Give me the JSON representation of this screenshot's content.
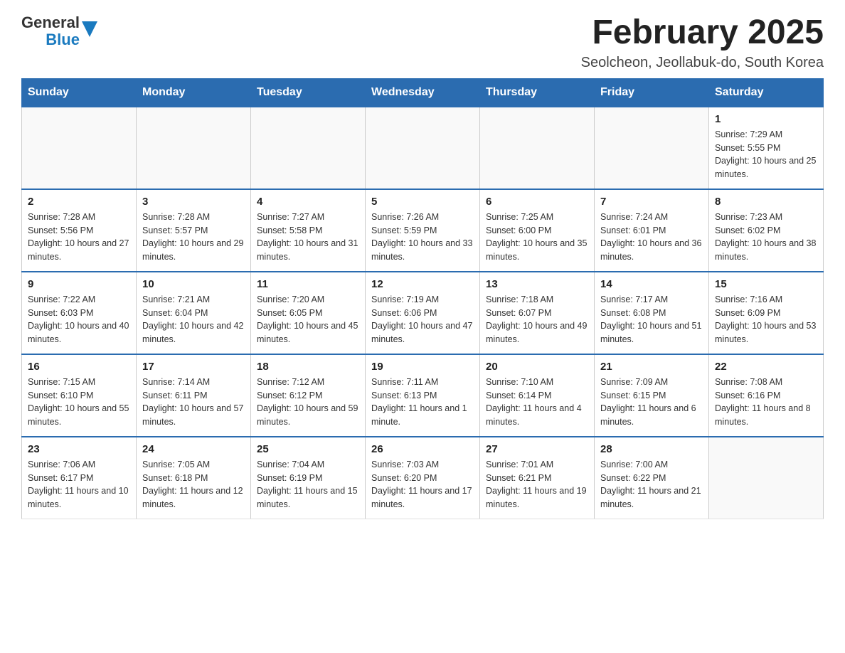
{
  "header": {
    "logo_general": "General",
    "logo_blue": "Blue",
    "month_title": "February 2025",
    "location": "Seolcheon, Jeollabuk-do, South Korea"
  },
  "days_of_week": [
    "Sunday",
    "Monday",
    "Tuesday",
    "Wednesday",
    "Thursday",
    "Friday",
    "Saturday"
  ],
  "weeks": [
    {
      "days": [
        {
          "number": "",
          "info": ""
        },
        {
          "number": "",
          "info": ""
        },
        {
          "number": "",
          "info": ""
        },
        {
          "number": "",
          "info": ""
        },
        {
          "number": "",
          "info": ""
        },
        {
          "number": "",
          "info": ""
        },
        {
          "number": "1",
          "info": "Sunrise: 7:29 AM\nSunset: 5:55 PM\nDaylight: 10 hours and 25 minutes."
        }
      ]
    },
    {
      "days": [
        {
          "number": "2",
          "info": "Sunrise: 7:28 AM\nSunset: 5:56 PM\nDaylight: 10 hours and 27 minutes."
        },
        {
          "number": "3",
          "info": "Sunrise: 7:28 AM\nSunset: 5:57 PM\nDaylight: 10 hours and 29 minutes."
        },
        {
          "number": "4",
          "info": "Sunrise: 7:27 AM\nSunset: 5:58 PM\nDaylight: 10 hours and 31 minutes."
        },
        {
          "number": "5",
          "info": "Sunrise: 7:26 AM\nSunset: 5:59 PM\nDaylight: 10 hours and 33 minutes."
        },
        {
          "number": "6",
          "info": "Sunrise: 7:25 AM\nSunset: 6:00 PM\nDaylight: 10 hours and 35 minutes."
        },
        {
          "number": "7",
          "info": "Sunrise: 7:24 AM\nSunset: 6:01 PM\nDaylight: 10 hours and 36 minutes."
        },
        {
          "number": "8",
          "info": "Sunrise: 7:23 AM\nSunset: 6:02 PM\nDaylight: 10 hours and 38 minutes."
        }
      ]
    },
    {
      "days": [
        {
          "number": "9",
          "info": "Sunrise: 7:22 AM\nSunset: 6:03 PM\nDaylight: 10 hours and 40 minutes."
        },
        {
          "number": "10",
          "info": "Sunrise: 7:21 AM\nSunset: 6:04 PM\nDaylight: 10 hours and 42 minutes."
        },
        {
          "number": "11",
          "info": "Sunrise: 7:20 AM\nSunset: 6:05 PM\nDaylight: 10 hours and 45 minutes."
        },
        {
          "number": "12",
          "info": "Sunrise: 7:19 AM\nSunset: 6:06 PM\nDaylight: 10 hours and 47 minutes."
        },
        {
          "number": "13",
          "info": "Sunrise: 7:18 AM\nSunset: 6:07 PM\nDaylight: 10 hours and 49 minutes."
        },
        {
          "number": "14",
          "info": "Sunrise: 7:17 AM\nSunset: 6:08 PM\nDaylight: 10 hours and 51 minutes."
        },
        {
          "number": "15",
          "info": "Sunrise: 7:16 AM\nSunset: 6:09 PM\nDaylight: 10 hours and 53 minutes."
        }
      ]
    },
    {
      "days": [
        {
          "number": "16",
          "info": "Sunrise: 7:15 AM\nSunset: 6:10 PM\nDaylight: 10 hours and 55 minutes."
        },
        {
          "number": "17",
          "info": "Sunrise: 7:14 AM\nSunset: 6:11 PM\nDaylight: 10 hours and 57 minutes."
        },
        {
          "number": "18",
          "info": "Sunrise: 7:12 AM\nSunset: 6:12 PM\nDaylight: 10 hours and 59 minutes."
        },
        {
          "number": "19",
          "info": "Sunrise: 7:11 AM\nSunset: 6:13 PM\nDaylight: 11 hours and 1 minute."
        },
        {
          "number": "20",
          "info": "Sunrise: 7:10 AM\nSunset: 6:14 PM\nDaylight: 11 hours and 4 minutes."
        },
        {
          "number": "21",
          "info": "Sunrise: 7:09 AM\nSunset: 6:15 PM\nDaylight: 11 hours and 6 minutes."
        },
        {
          "number": "22",
          "info": "Sunrise: 7:08 AM\nSunset: 6:16 PM\nDaylight: 11 hours and 8 minutes."
        }
      ]
    },
    {
      "days": [
        {
          "number": "23",
          "info": "Sunrise: 7:06 AM\nSunset: 6:17 PM\nDaylight: 11 hours and 10 minutes."
        },
        {
          "number": "24",
          "info": "Sunrise: 7:05 AM\nSunset: 6:18 PM\nDaylight: 11 hours and 12 minutes."
        },
        {
          "number": "25",
          "info": "Sunrise: 7:04 AM\nSunset: 6:19 PM\nDaylight: 11 hours and 15 minutes."
        },
        {
          "number": "26",
          "info": "Sunrise: 7:03 AM\nSunset: 6:20 PM\nDaylight: 11 hours and 17 minutes."
        },
        {
          "number": "27",
          "info": "Sunrise: 7:01 AM\nSunset: 6:21 PM\nDaylight: 11 hours and 19 minutes."
        },
        {
          "number": "28",
          "info": "Sunrise: 7:00 AM\nSunset: 6:22 PM\nDaylight: 11 hours and 21 minutes."
        },
        {
          "number": "",
          "info": ""
        }
      ]
    }
  ]
}
